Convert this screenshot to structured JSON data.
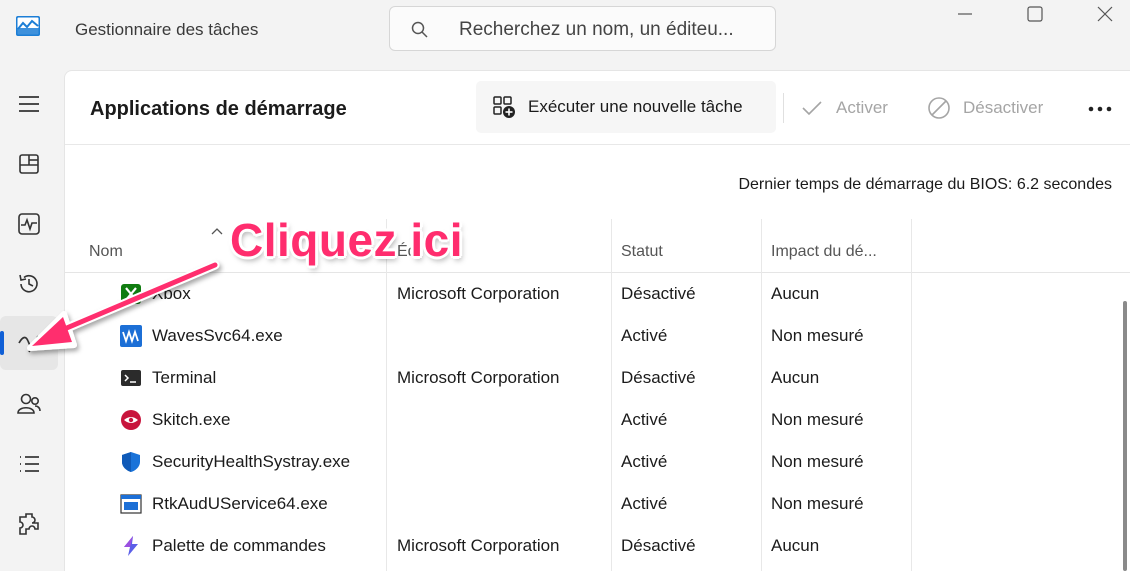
{
  "window": {
    "title": "Gestionnaire des tâches",
    "app_icon": "task-manager-icon",
    "search_placeholder": "Recherchez un nom, un éditeu...",
    "controls": [
      "minimize-icon",
      "maximize-icon",
      "close-icon"
    ]
  },
  "nav": {
    "items": [
      {
        "icon": "hamburger-menu-icon"
      },
      {
        "icon": "processes-icon"
      },
      {
        "icon": "performance-icon"
      },
      {
        "icon": "app-history-icon"
      },
      {
        "icon": "startup-apps-icon",
        "selected": true
      },
      {
        "icon": "users-icon"
      },
      {
        "icon": "details-icon"
      },
      {
        "icon": "services-icon"
      }
    ]
  },
  "page": {
    "title": "Applications de démarrage",
    "actions": {
      "run_new_task": "Exécuter une nouvelle tâche",
      "enable": "Activer",
      "disable": "Désactiver",
      "more": "more-options-icon"
    },
    "bios_time": "Dernier temps de démarrage du BIOS: 6.2 secondes"
  },
  "table": {
    "columns": [
      "Nom",
      "Éd",
      "Statut",
      "Impact du dé..."
    ],
    "rows": [
      {
        "name": "Xbox",
        "publisher": "Microsoft Corporation",
        "status": "Désactivé",
        "impact": "Aucun",
        "icon": "xbox-icon"
      },
      {
        "name": "WavesSvc64.exe",
        "publisher": "",
        "status": "Activé",
        "impact": "Non mesuré",
        "icon": "waves-icon"
      },
      {
        "name": "Terminal",
        "publisher": "Microsoft Corporation",
        "status": "Désactivé",
        "impact": "Aucun",
        "icon": "terminal-icon"
      },
      {
        "name": "Skitch.exe",
        "publisher": "",
        "status": "Activé",
        "impact": "Non mesuré",
        "icon": "skitch-icon"
      },
      {
        "name": "SecurityHealthSystray.exe",
        "publisher": "",
        "status": "Activé",
        "impact": "Non mesuré",
        "icon": "security-shield-icon"
      },
      {
        "name": "RtkAudUService64.exe",
        "publisher": "",
        "status": "Activé",
        "impact": "Non mesuré",
        "icon": "realtek-audio-icon"
      },
      {
        "name": "Palette de commandes",
        "publisher": "Microsoft Corporation",
        "status": "Désactivé",
        "impact": "Aucun",
        "icon": "command-palette-icon"
      }
    ]
  },
  "annotation": {
    "text": "Cliquez ici",
    "color": "#ff2d6e"
  },
  "colors": {
    "accent": "#0f5fd6",
    "disabled_text": "#a5a5a5"
  }
}
